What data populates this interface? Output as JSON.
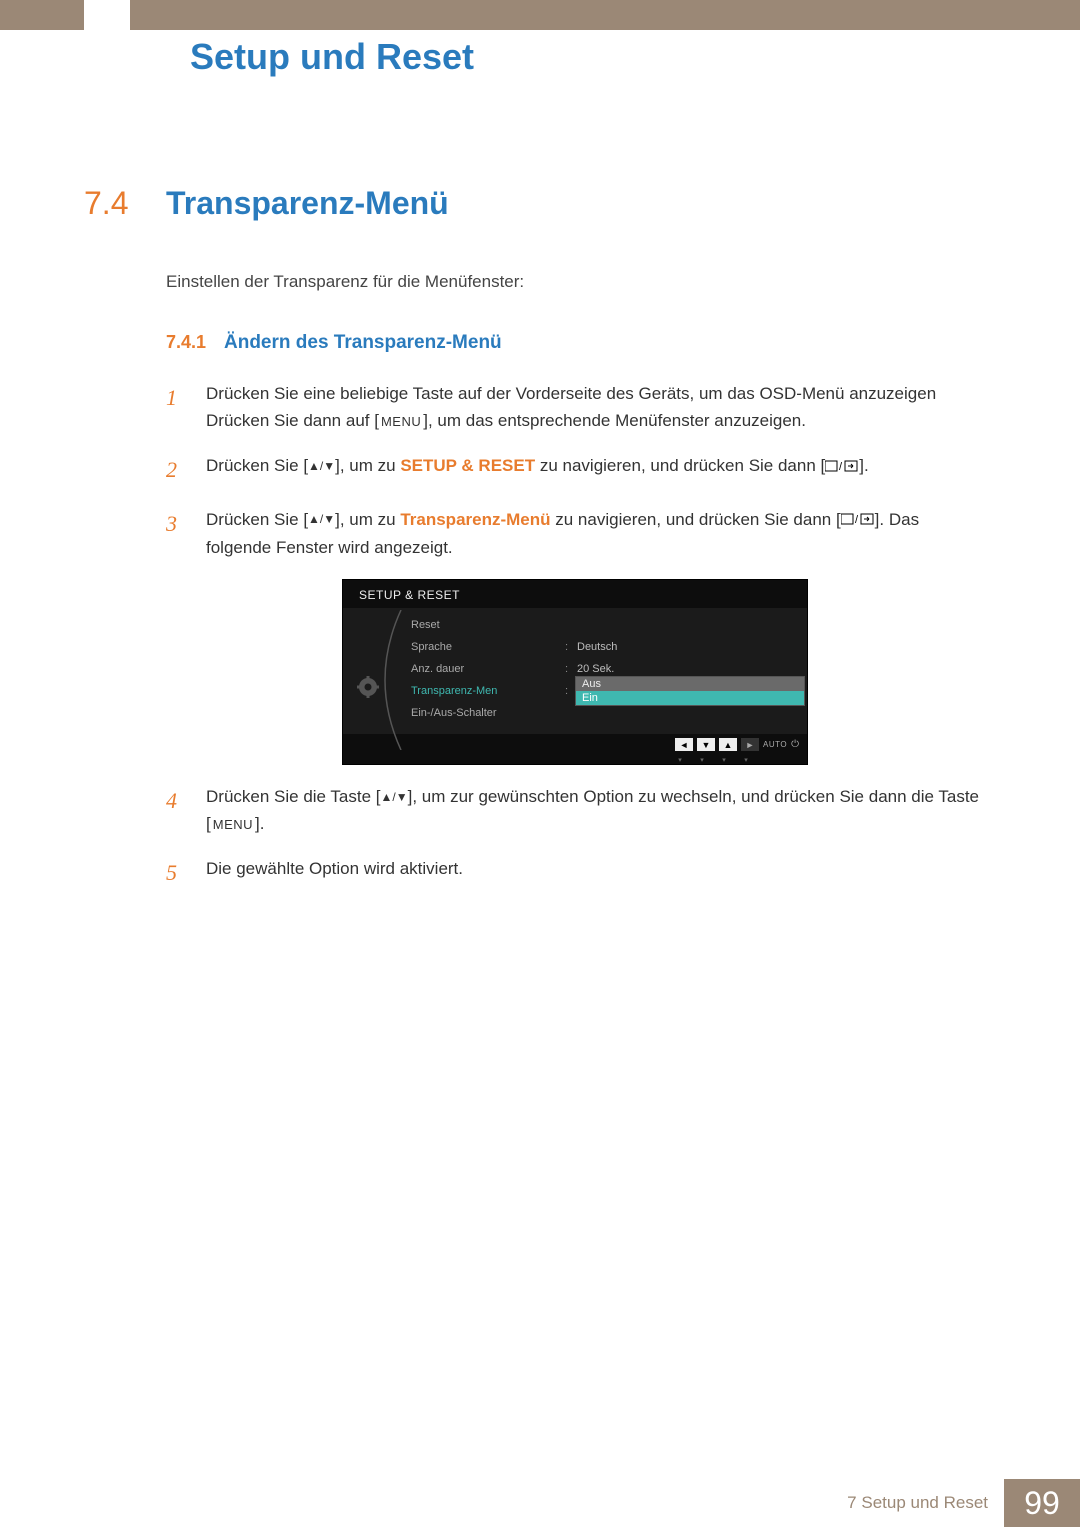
{
  "header": {
    "chapter_title": "Setup und Reset"
  },
  "section": {
    "number": "7.4",
    "title": "Transparenz-Menü",
    "intro": "Einstellen der Transparenz für die Menüfenster:"
  },
  "subsection": {
    "number": "7.4.1",
    "title": "Ändern des Transparenz-Menü"
  },
  "steps": {
    "s1": {
      "num": "1",
      "t1": "Drücken Sie eine beliebige Taste auf der Vorderseite des Geräts, um das OSD-Menü anzuzeigen Drücken Sie dann auf [",
      "menu": "MENU",
      "t2": "], um das entsprechende Menüfenster anzuzeigen."
    },
    "s2": {
      "num": "2",
      "t1": "Drücken Sie [",
      "t2": "], um zu ",
      "bold": "SETUP & RESET",
      "t3": " zu navigieren, und drücken Sie dann [",
      "t4": "]."
    },
    "s3": {
      "num": "3",
      "t1": "Drücken Sie [",
      "t2": "], um zu ",
      "bold": "Transparenz-Menü",
      "t3": " zu navigieren, und drücken Sie dann [",
      "t4": "]. Das folgende Fenster wird angezeigt."
    },
    "s4": {
      "num": "4",
      "t1": "Drücken Sie die Taste [",
      "t2": "], um zur gewünschten Option zu wechseln, und drücken Sie dann die Taste [",
      "menu": "MENU",
      "t3": "]."
    },
    "s5": {
      "num": "5",
      "t1": "Die gewählte Option wird aktiviert."
    }
  },
  "osd": {
    "header": "SETUP & RESET",
    "rows": {
      "reset": "Reset",
      "sprache": "Sprache",
      "sprache_val": "Deutsch",
      "anz": "Anz. dauer",
      "anz_val": "20 Sek.",
      "transp": "Transparenz-Men",
      "ein_aus": "Ein-/Aus-Schalter"
    },
    "dropdown": {
      "aus": "Aus",
      "ein": "Ein"
    },
    "footer": {
      "auto": "AUTO"
    }
  },
  "footer": {
    "label": "7 Setup und Reset",
    "page": "99"
  }
}
